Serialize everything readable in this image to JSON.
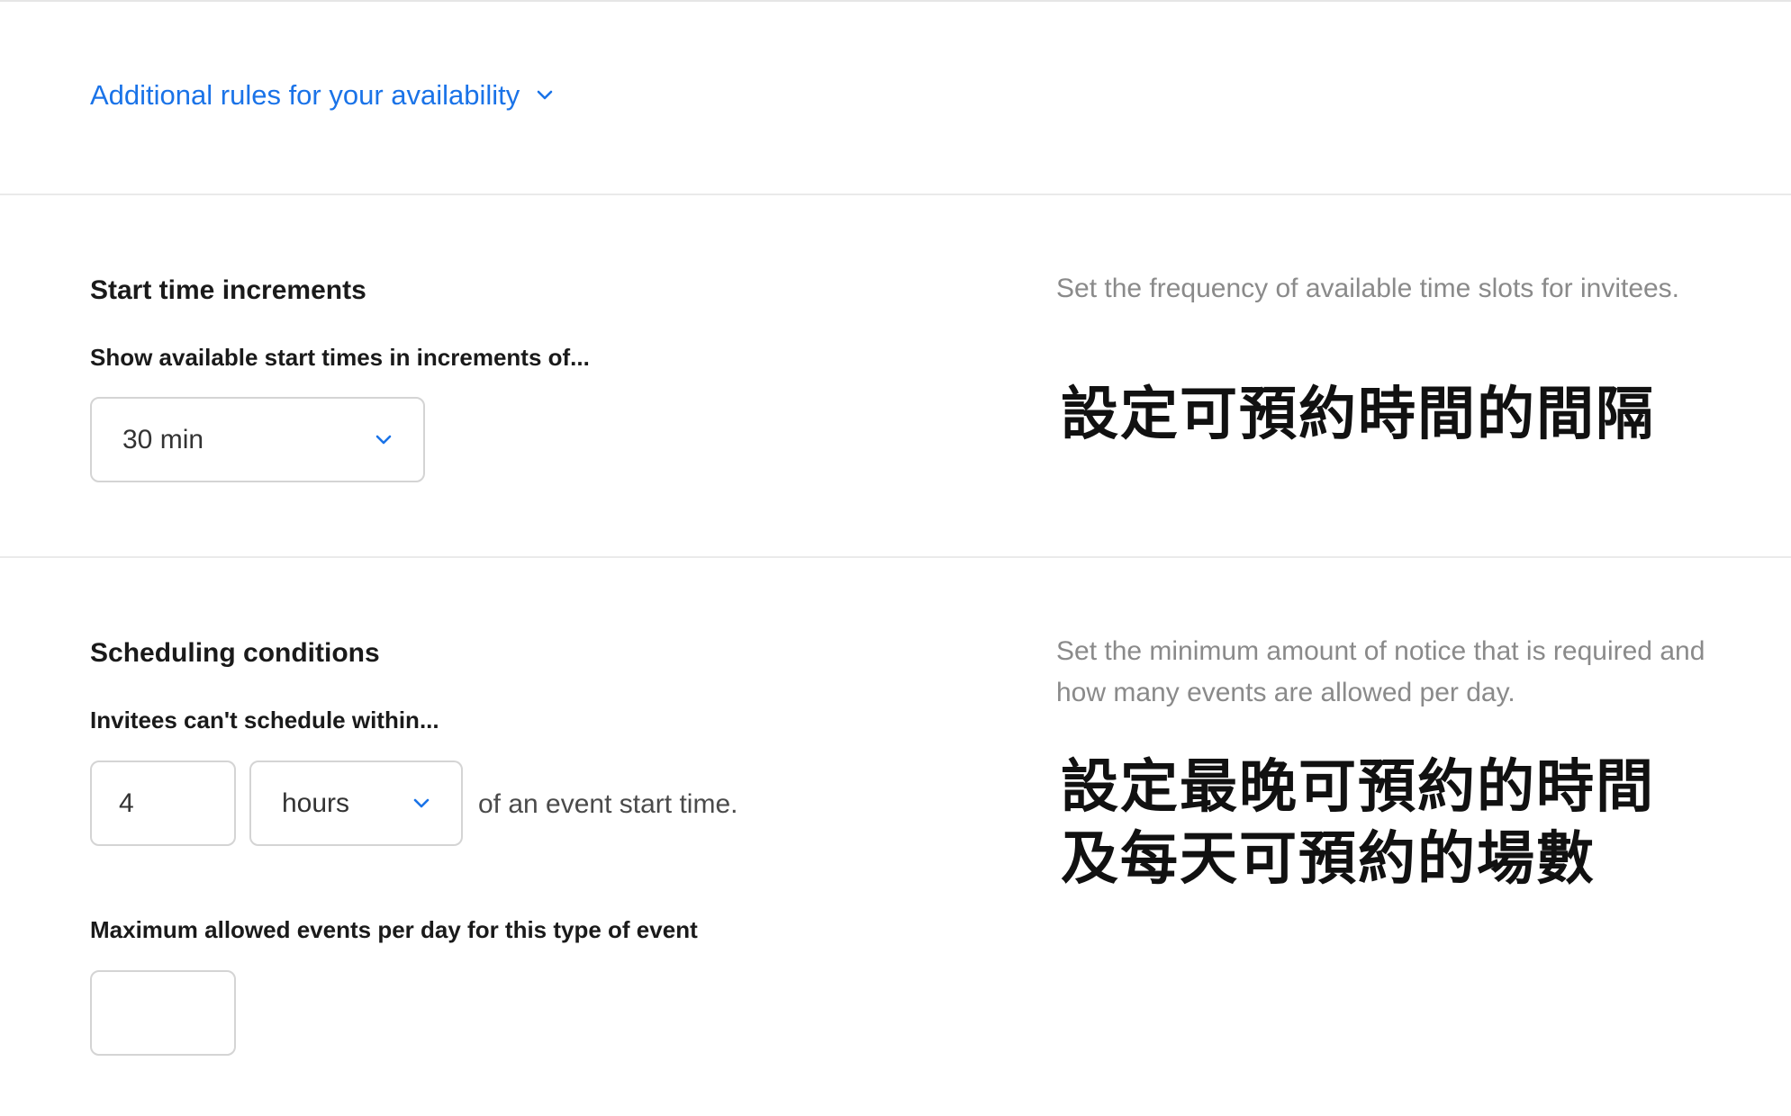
{
  "availability": {
    "rules_link_label": "Additional rules for your availability"
  },
  "start_time_increments": {
    "title": "Start time increments",
    "label": "Show available start times in increments of...",
    "selected": "30 min",
    "help": "Set the frequency of available time slots for invitees.",
    "note": "設定可預約時間的間隔"
  },
  "scheduling_conditions": {
    "title": "Scheduling conditions",
    "notice_label": "Invitees can't schedule within...",
    "notice_value": "4",
    "notice_unit": "hours",
    "notice_suffix": "of an event start time.",
    "max_label": "Maximum allowed events per day for this type of event",
    "max_value": "",
    "help": "Set the minimum amount of notice that is required and how many events are allowed per day.",
    "note_line1": "設定最晚可預約的時間",
    "note_line2": "及每天可預約的場數"
  },
  "colors": {
    "link": "#1a73e8",
    "help_text": "#8a8a8a",
    "border": "#d4d4d4"
  },
  "icons": {
    "dropdown": "chevron-down-icon"
  }
}
